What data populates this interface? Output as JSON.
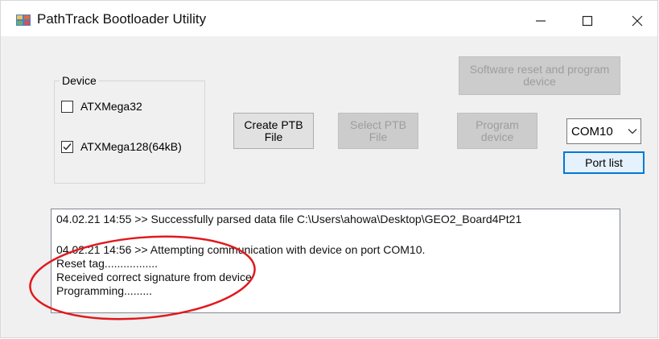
{
  "window": {
    "title": "PathTrack Bootloader Utility",
    "icons": {
      "app": "app-icon",
      "minimize": "minimize-icon",
      "maximize": "maximize-icon",
      "close": "close-icon"
    }
  },
  "device_group": {
    "legend": "Device",
    "options": [
      {
        "label": "ATXMega32",
        "checked": false
      },
      {
        "label": "ATXMega128(64kB)",
        "checked": true
      }
    ]
  },
  "buttons": {
    "create_ptb": "Create PTB\nFile",
    "select_ptb": "Select PTB\nFile",
    "program_device": "Program\ndevice",
    "software_reset": "Software reset and program\ndevice",
    "port_list": "Port list"
  },
  "port": {
    "selected": "COM10"
  },
  "log": {
    "lines": [
      "04.02.21 14:55 >> Successfully parsed data file C:\\Users\\ahowa\\Desktop\\GEO2_Board4Pt21",
      "04.02.21 14:56 >> Attempting communication with device on port COM10.",
      "Reset tag.................",
      "Received correct signature from device",
      "Programming........."
    ]
  },
  "colors": {
    "annotation": "#e0191e",
    "focus_border": "#0078d7"
  }
}
